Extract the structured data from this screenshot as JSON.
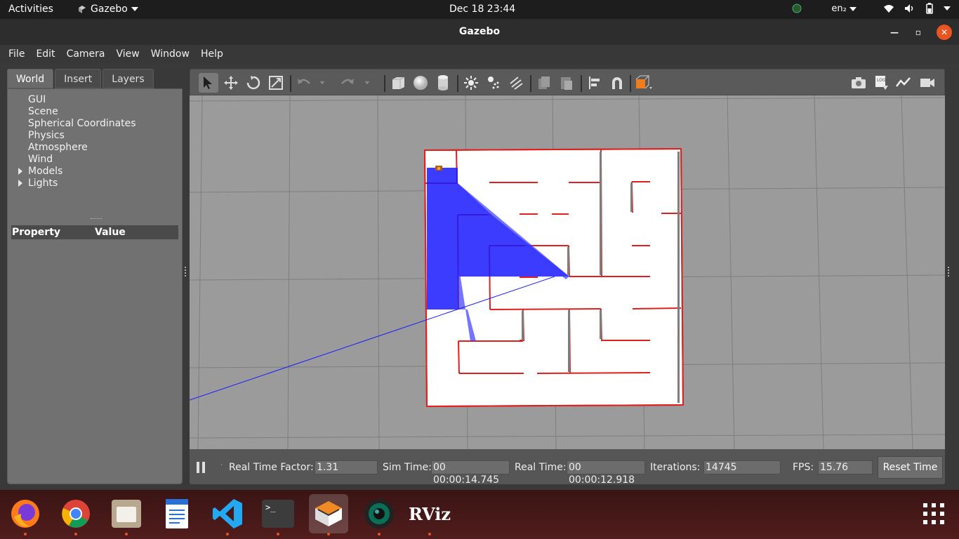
{
  "topbar": {
    "activities": "Activities",
    "app_name": "Gazebo",
    "clock": "Dec 18  23:44",
    "input_lang": "en₂"
  },
  "window": {
    "title": "Gazebo"
  },
  "menu": [
    "File",
    "Edit",
    "Camera",
    "View",
    "Window",
    "Help"
  ],
  "left_panel": {
    "tabs": [
      "World",
      "Insert",
      "Layers"
    ],
    "active_tab": "World",
    "tree": [
      {
        "label": "GUI",
        "expandable": false
      },
      {
        "label": "Scene",
        "expandable": false
      },
      {
        "label": "Spherical Coordinates",
        "expandable": false
      },
      {
        "label": "Physics",
        "expandable": false
      },
      {
        "label": "Atmosphere",
        "expandable": false
      },
      {
        "label": "Wind",
        "expandable": false
      },
      {
        "label": "Models",
        "expandable": true
      },
      {
        "label": "Lights",
        "expandable": true
      }
    ],
    "property_header": {
      "property": "Property",
      "value": "Value"
    }
  },
  "toolbar": {
    "tools": [
      "select-mode-icon",
      "translate-mode-icon",
      "rotate-mode-icon",
      "scale-mode-icon",
      "undo-icon",
      "undo-history-icon",
      "redo-icon",
      "redo-history-icon",
      "box-shape-icon",
      "sphere-shape-icon",
      "cylinder-shape-icon",
      "point-light-icon",
      "spot-light-icon",
      "directional-light-icon",
      "copy-icon",
      "paste-icon",
      "align-icon",
      "snap-icon",
      "view-angle-icon"
    ],
    "right_tools": [
      "screenshot-icon",
      "log-icon",
      "plot-icon",
      "record-video-icon"
    ]
  },
  "simbar": {
    "rtf_label": "Real Time Factor:",
    "rtf_value": "1.31",
    "sim_time_label": "Sim Time:",
    "sim_time_value": "00 00:00:14.745",
    "real_time_label": "Real Time:",
    "real_time_value": "00 00:00:12.918",
    "iterations_label": "Iterations:",
    "iterations_value": "14745",
    "fps_label": "FPS:",
    "fps_value": "15.76",
    "reset_label": "Reset Time"
  },
  "dock": {
    "apps": [
      "firefox-icon",
      "chrome-icon",
      "files-icon",
      "text-editor-icon",
      "vscode-icon",
      "terminal-icon",
      "gazebo-icon",
      "camera-app-icon",
      "rviz-icon"
    ],
    "rviz_text": "RViz",
    "terminal_text": ">_"
  },
  "colors": {
    "accent": "#e95420",
    "laser": "#1a1aff",
    "wall_outline": "#e02020",
    "grid_bg": "#9b9b9b"
  }
}
